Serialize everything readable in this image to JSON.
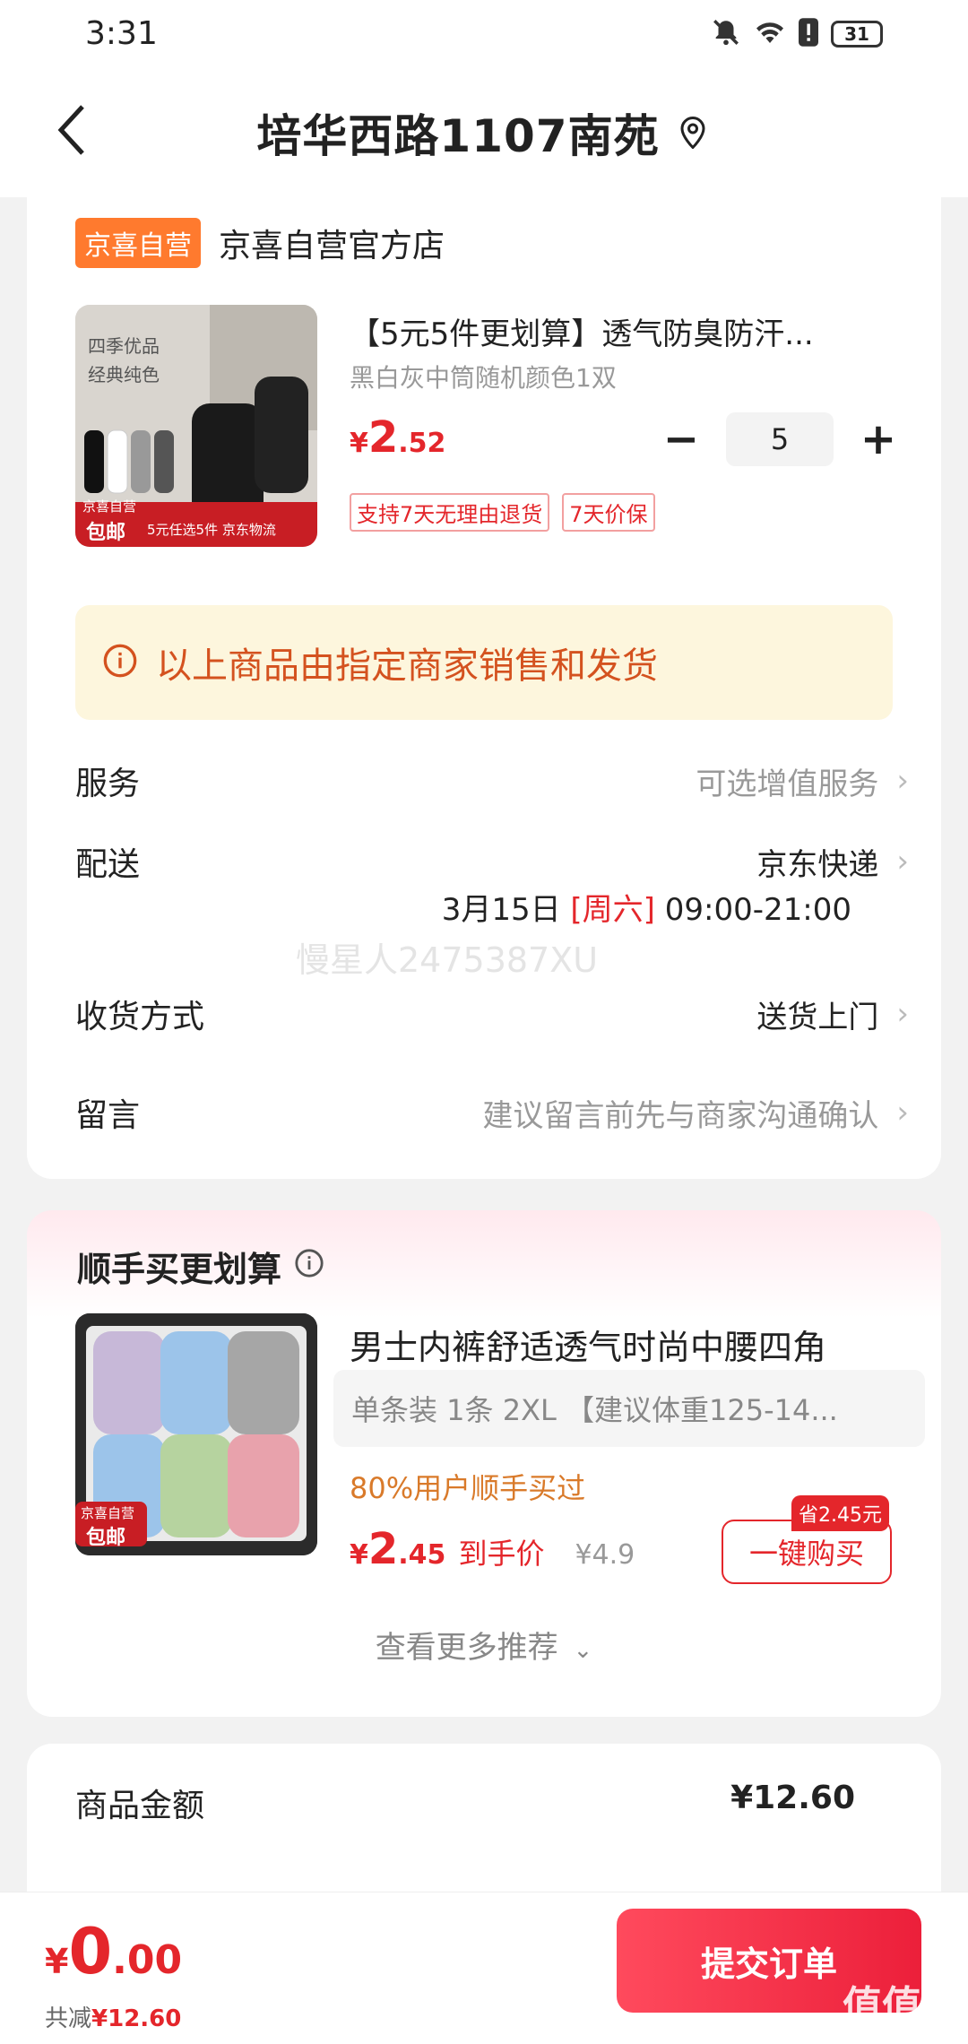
{
  "status": {
    "time": "3:31",
    "battery": "31"
  },
  "nav": {
    "title": "培华西路1107南苑"
  },
  "store": {
    "badge": "京喜自营",
    "name": "京喜自营官方店"
  },
  "product": {
    "title": "【5元5件更划算】透气防臭防汗...",
    "spec": "黑白灰中筒随机颜色1双",
    "price_symbol": "¥",
    "price_int": "2",
    "price_dec": ".52",
    "qty": "5",
    "tags": [
      "支持7天无理由退货",
      "7天价保"
    ],
    "img_text": {
      "line1": "四季优品",
      "line2": "经典纯色",
      "badge_top": "京喜自营",
      "badge_main": "包邮",
      "promo": "5元任选5件 京东物流"
    }
  },
  "notice": {
    "text": "以上商品由指定商家销售和发货"
  },
  "rows": {
    "service_label": "服务",
    "service_value": "可选增值服务",
    "delivery_label": "配送",
    "delivery_value": "京东快递",
    "delivery_date": "3月15日",
    "delivery_weekday": "[周六]",
    "delivery_time": "09:00-21:00",
    "receive_label": "收货方式",
    "receive_value": "送货上门",
    "message_label": "留言",
    "message_placeholder": "建议留言前先与商家沟通确认"
  },
  "watermark": "慢星人2475387XU",
  "recommend": {
    "title": "顺手买更划算",
    "name": "男士内裤舒适透气时尚中腰四角",
    "spec": "单条装 1条   2XL 【建议体重125-14...",
    "social": "80%用户顺手买过",
    "price_symbol": "¥",
    "price_int": "2",
    "price_dec": ".45",
    "price_label": "到手价",
    "orig_price": "¥4.9",
    "save_tag": "省2.45元",
    "buy_label": "一键购买",
    "more": "查看更多推荐",
    "img_badge_top": "京喜自营",
    "img_badge_main": "包邮"
  },
  "summary": {
    "label": "商品金额",
    "value": "¥12.60"
  },
  "bottom": {
    "symbol": "¥",
    "total_int": "0",
    "total_dec": ".00",
    "discount_label": "共减",
    "discount_value": "¥12.60",
    "submit": "提交订单",
    "corner_logo": "值值值"
  }
}
